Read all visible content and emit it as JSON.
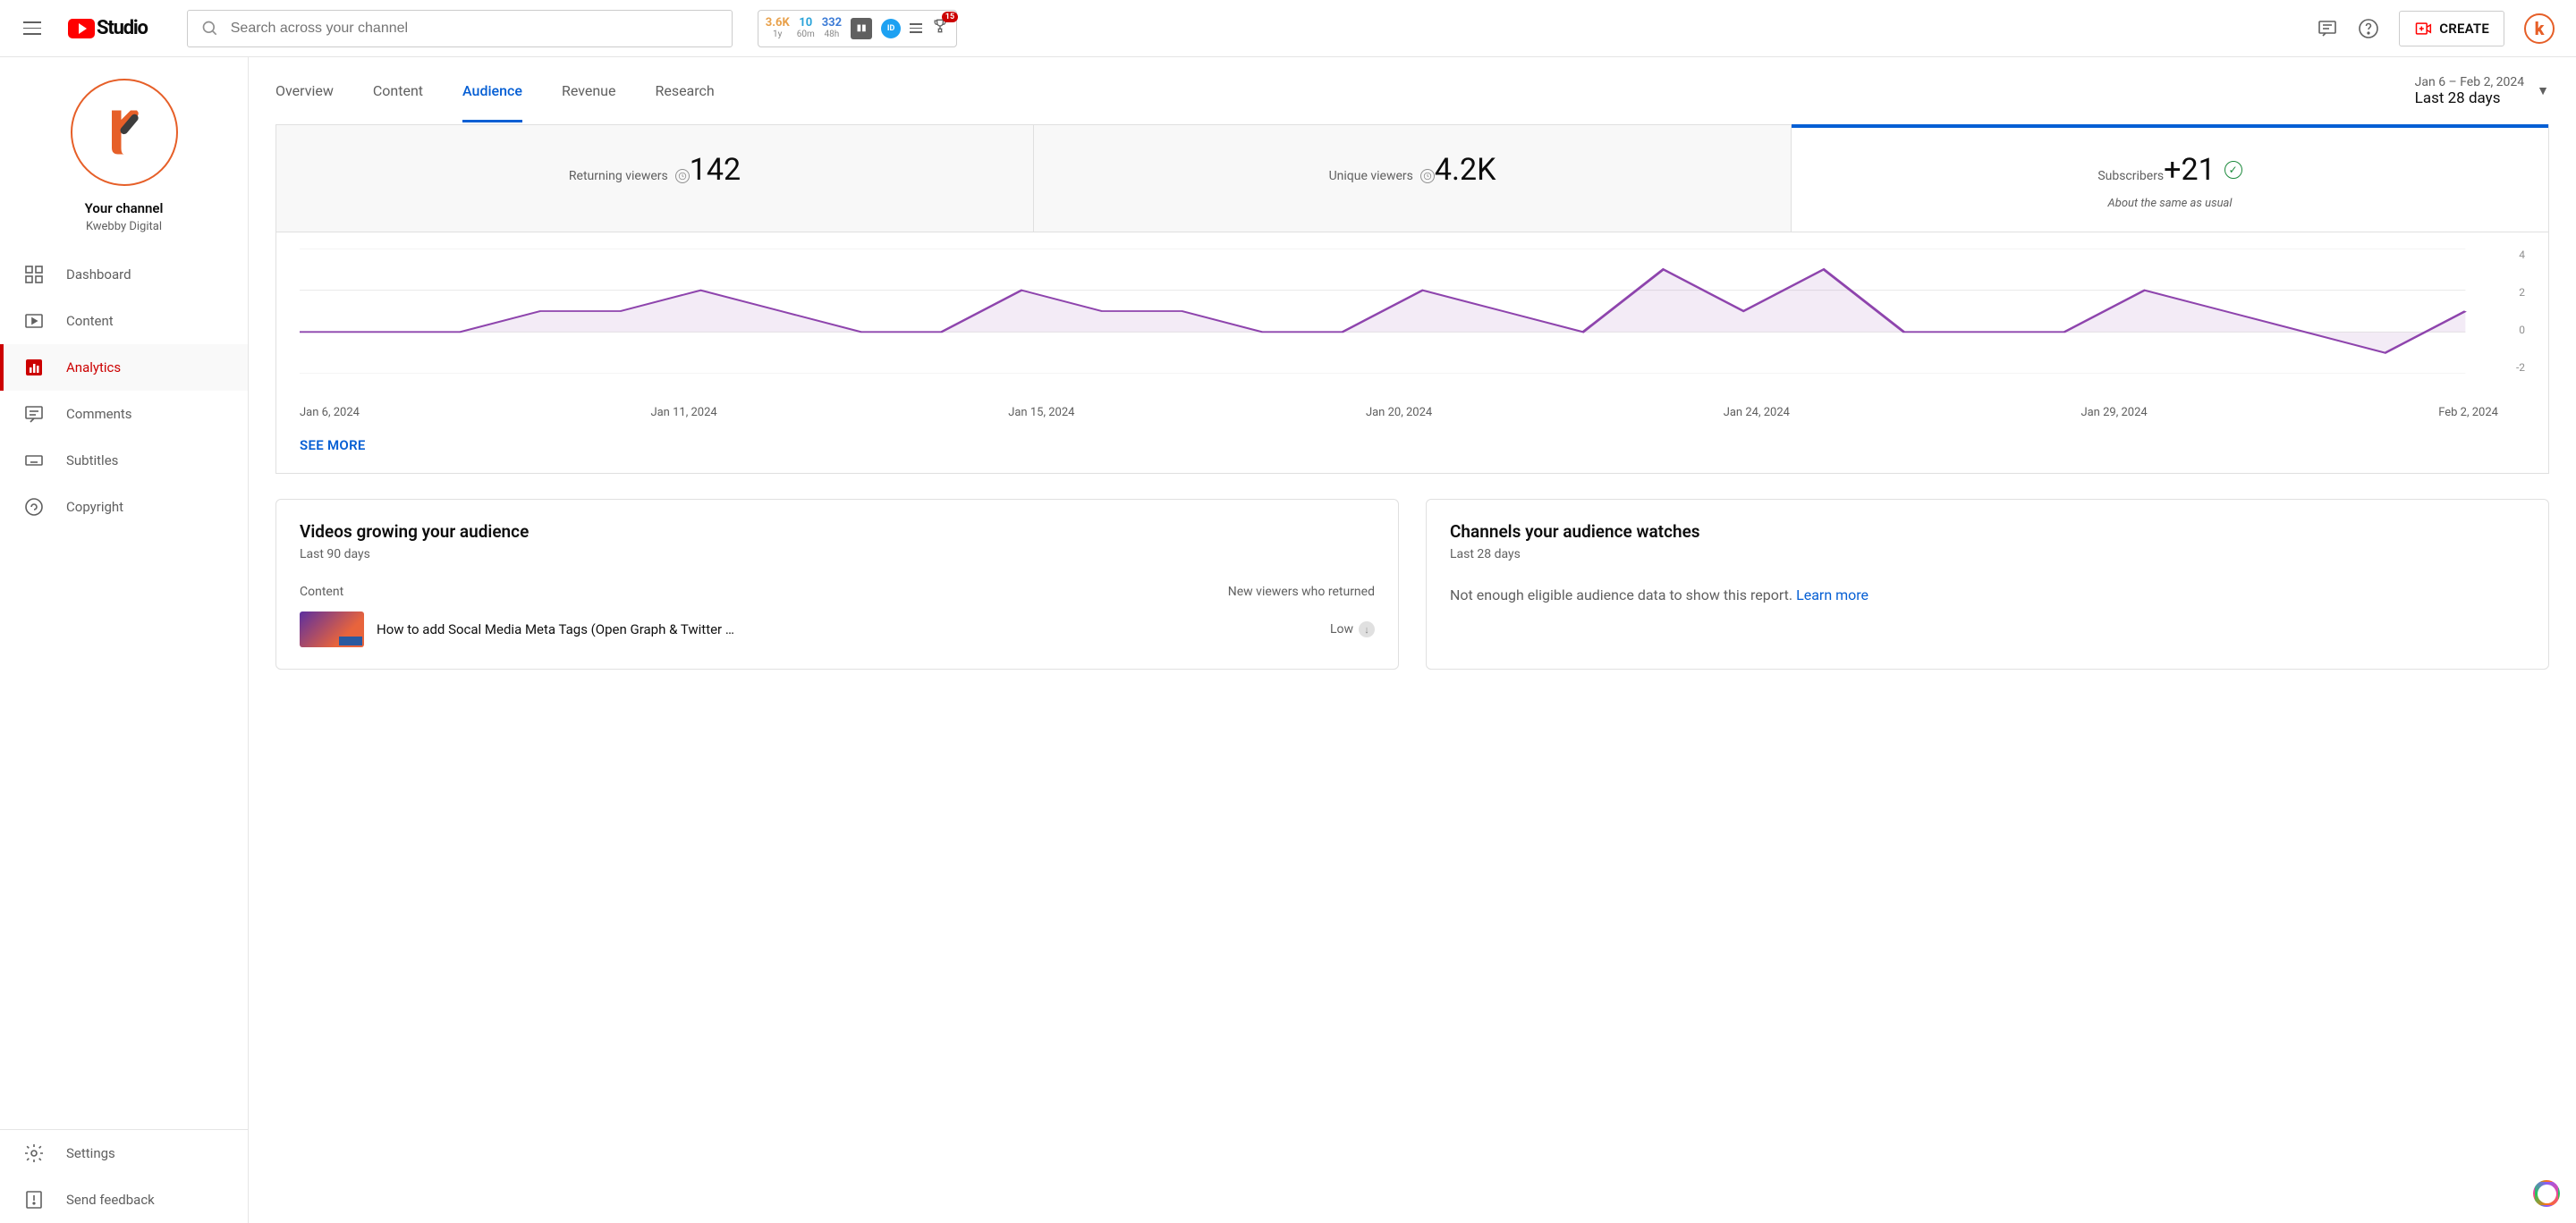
{
  "header": {
    "logo_text": "Studio",
    "search_placeholder": "Search across your channel",
    "ext": {
      "s1_top": "3.6K",
      "s1_bot": "1y",
      "s2_top": "10",
      "s2_bot": "60m",
      "s3_top": "332",
      "s3_bot": "48h",
      "badge": "15"
    },
    "create": "CREATE"
  },
  "sidebar": {
    "your_channel": "Your channel",
    "channel_name": "Kwebby Digital",
    "items": [
      "Dashboard",
      "Content",
      "Analytics",
      "Comments",
      "Subtitles",
      "Copyright"
    ],
    "active_index": 2,
    "bottom": [
      "Settings",
      "Send feedback"
    ]
  },
  "tabs": {
    "items": [
      "Overview",
      "Content",
      "Audience",
      "Revenue",
      "Research"
    ],
    "active_index": 2,
    "date_range": "Jan 6 – Feb 2, 2024",
    "period_label": "Last 28 days"
  },
  "metrics": [
    {
      "label": "Returning viewers",
      "value": "142",
      "info": true
    },
    {
      "label": "Unique viewers",
      "value": "4.2K",
      "info": true
    },
    {
      "label": "Subscribers",
      "value": "+21",
      "check": true,
      "sub": "About the same as usual",
      "selected": true
    }
  ],
  "chart_data": {
    "type": "line",
    "ylim": [
      -2,
      4
    ],
    "y_ticks": [
      4,
      2,
      0,
      -2
    ],
    "x_ticks": [
      "Jan 6, 2024",
      "Jan 11, 2024",
      "Jan 15, 2024",
      "Jan 20, 2024",
      "Jan 24, 2024",
      "Jan 29, 2024",
      "Feb 2, 2024"
    ],
    "values": [
      0,
      0,
      0,
      1,
      1,
      2,
      1,
      0,
      0,
      2,
      1,
      1,
      0,
      0,
      2,
      1,
      0,
      3,
      1,
      3,
      0,
      0,
      0,
      2,
      1,
      0,
      -1,
      1
    ]
  },
  "see_more": "SEE MORE",
  "card_videos": {
    "title": "Videos growing your audience",
    "period": "Last 90 days",
    "col1": "Content",
    "col2": "New viewers who returned",
    "rows": [
      {
        "title": "How to add Socal Media Meta Tags (Open Graph & Twitter …",
        "stat": "Low"
      }
    ]
  },
  "card_channels": {
    "title": "Channels your audience watches",
    "period": "Last 28 days",
    "text": "Not enough eligible audience data to show this report.",
    "learn": "Learn more"
  }
}
